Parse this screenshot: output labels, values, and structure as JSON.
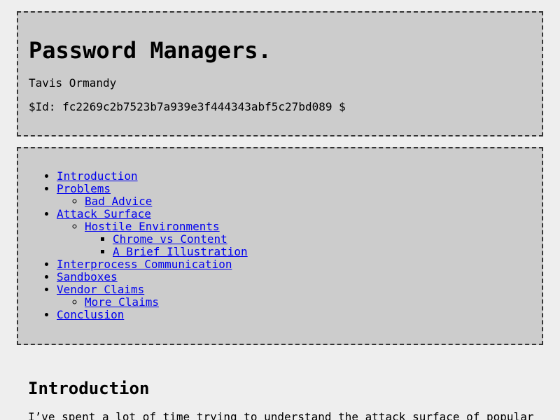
{
  "header": {
    "title": "Password Managers.",
    "author": "Tavis Ormandy",
    "revision": "$Id: fc2269c2b7523b7a939e3f444343abf5c27bd089 $"
  },
  "toc": {
    "introduction": "Introduction",
    "problems": "Problems",
    "bad_advice": "Bad Advice",
    "attack_surface": "Attack Surface",
    "hostile_environments": "Hostile Environments",
    "chrome_vs_content": "Chrome vs Content",
    "brief_illustration": "A Brief Illustration",
    "interprocess": "Interprocess Communication",
    "sandboxes": "Sandboxes",
    "vendor_claims": "Vendor Claims",
    "more_claims": "More Claims",
    "conclusion": "Conclusion"
  },
  "content": {
    "introduction_heading": "Introduction",
    "introduction_text": "I’ve spent a lot of time trying to understand the attack surface of popular"
  }
}
